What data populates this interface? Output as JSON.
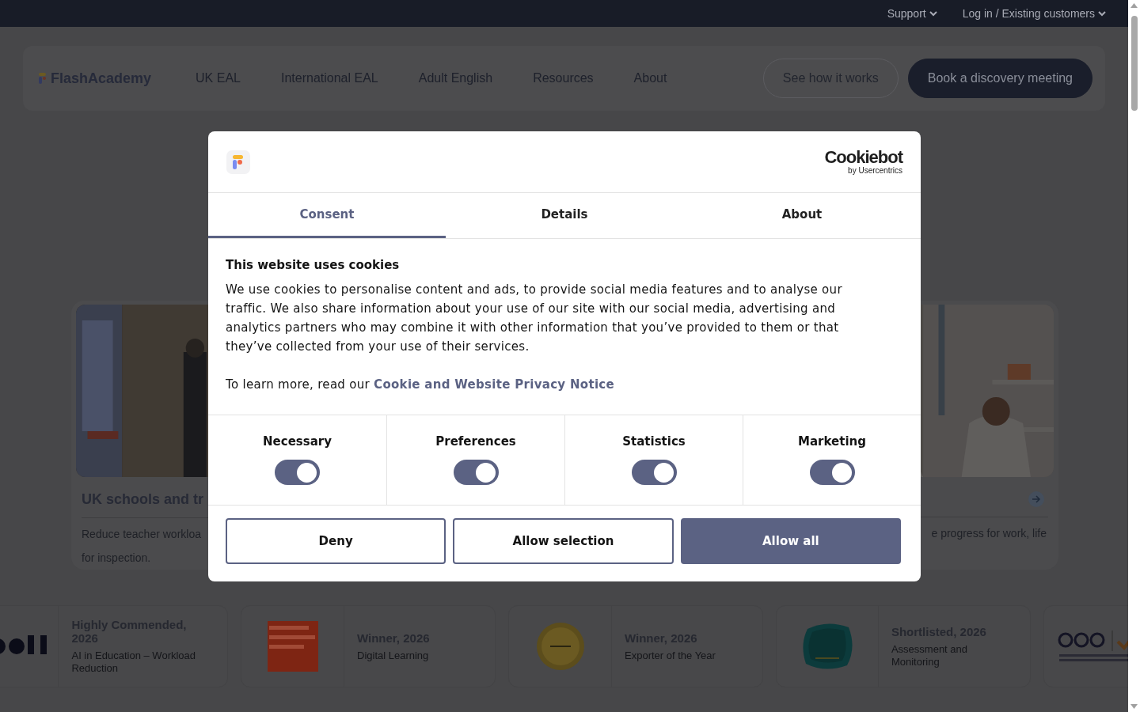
{
  "top_bar": {
    "links": [
      {
        "label": "Support"
      },
      {
        "label": "Log in / Existing customers"
      }
    ]
  },
  "nav": {
    "logo": "FlashAcademy",
    "items": [
      "UK EAL",
      "International EAL",
      "Adult English",
      "Resources",
      "About"
    ],
    "buttons": [
      {
        "label": "See how it works",
        "kind": "outline"
      },
      {
        "label": "Book a discovery meeting",
        "kind": "primary"
      }
    ]
  },
  "cards": [
    {
      "kind": "left",
      "title": "UK schools and tr",
      "description_lines": [
        "Reduce teacher workloa",
        "for inspection."
      ]
    },
    {
      "kind": "right",
      "description_lines": [
        "e progress for work, life"
      ]
    }
  ],
  "awards": [
    {
      "kind": "bett",
      "title": "Highly Commended, 2026",
      "subtitle": "AI in Education – Workload Reduction"
    },
    {
      "kind": "lea",
      "title": "Winner, 2026",
      "subtitle": "Digital Learning"
    },
    {
      "kind": "gold",
      "title": "Winner, 2026",
      "subtitle": "Exporter of the Year"
    },
    {
      "kind": "teach",
      "title": "Shortlisted, 2026",
      "subtitle": "Assessment and Monitoring"
    },
    {
      "kind": "besa"
    }
  ],
  "dialog": {
    "brand": "Cookiebot",
    "brand_sub": "by Usercentrics",
    "tabs": [
      {
        "label": "Consent",
        "selected": true
      },
      {
        "label": "Details",
        "selected": false
      },
      {
        "label": "About",
        "selected": false
      }
    ],
    "heading": "This website uses cookies",
    "paragraph": "We use cookies to personalise content and ads, to provide social media features and to analyse our traffic. We also share information about your use of our site with our social media, advertising and analytics partners who may combine it with other information that you’ve provided to them or that they’ve collected from your use of their services.",
    "link_prefix": "To learn more, read our",
    "link": "Cookie and Website Privacy Notice",
    "categories": [
      {
        "label": "Necessary",
        "on": true
      },
      {
        "label": "Preferences",
        "on": true
      },
      {
        "label": "Statistics",
        "on": true
      },
      {
        "label": "Marketing",
        "on": true
      }
    ],
    "buttons": [
      {
        "label": "Deny",
        "kind": "outline"
      },
      {
        "label": "Allow selection",
        "kind": "outline"
      },
      {
        "label": "Allow all",
        "kind": "primary"
      }
    ]
  }
}
